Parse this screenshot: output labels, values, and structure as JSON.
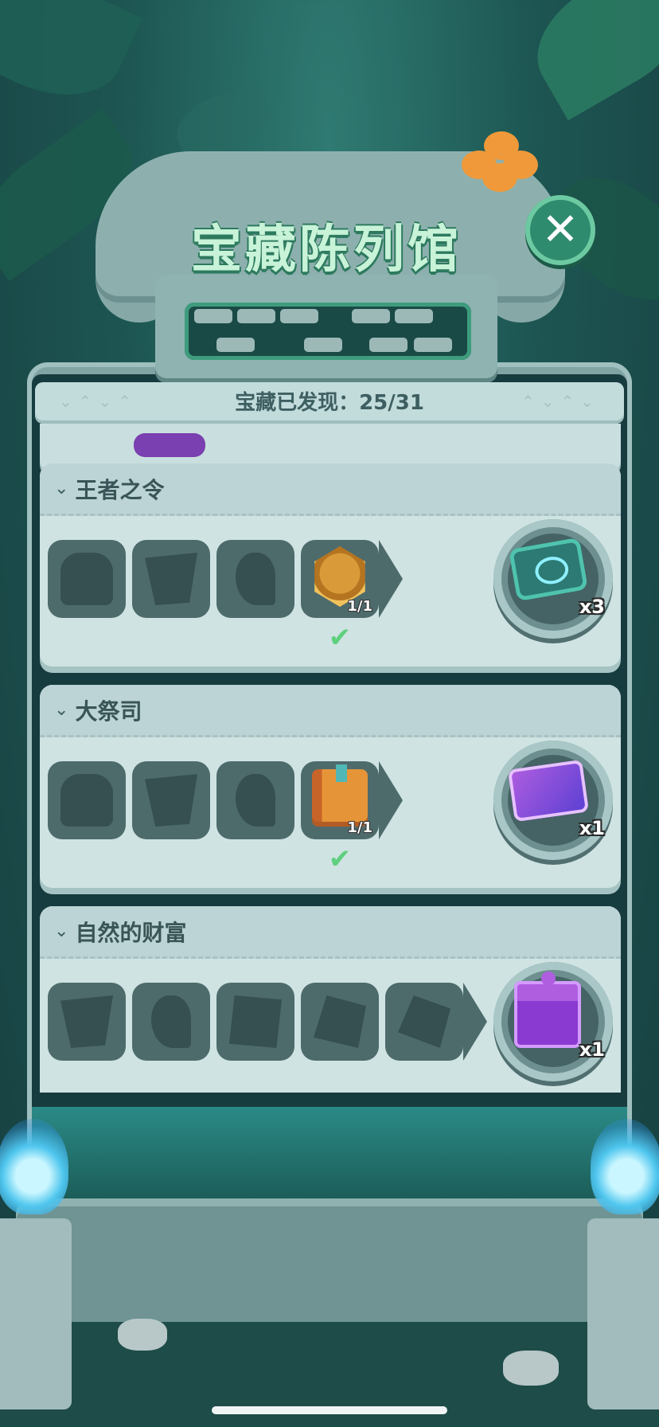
{
  "header": {
    "title": "宝藏陈列馆",
    "close_icon": "close-icon"
  },
  "counter": {
    "label": "宝藏已发现：25/31"
  },
  "collections": [
    {
      "title": "王者之令",
      "items": [
        {
          "icon": "glove-silhouette",
          "found": false
        },
        {
          "icon": "scroll-silhouette",
          "found": false
        },
        {
          "icon": "mickey-torch-silhouette",
          "found": false
        },
        {
          "icon": "mickey-medal",
          "found": true,
          "count": "1/1"
        }
      ],
      "reward": {
        "icon": "eye-ticket-icon",
        "qty": "x3"
      }
    },
    {
      "title": "大祭司",
      "items": [
        {
          "icon": "glove-silhouette",
          "found": false
        },
        {
          "icon": "scroll-silhouette",
          "found": false
        },
        {
          "icon": "mickey-torch-silhouette",
          "found": false
        },
        {
          "icon": "mickey-book",
          "found": true,
          "count": "1/1"
        }
      ],
      "reward": {
        "icon": "mickey-card-icon",
        "qty": "x1"
      }
    },
    {
      "title": "自然的财富",
      "items": [
        {
          "icon": "scroll-silhouette",
          "found": false
        },
        {
          "icon": "mickey-torch-silhouette",
          "found": false
        },
        {
          "icon": "tablet-silhouette",
          "found": false
        },
        {
          "icon": "rock-silhouette",
          "found": false
        },
        {
          "icon": "hexagon-silhouette",
          "found": false
        }
      ],
      "reward": {
        "icon": "gift-box-icon",
        "qty": "x1"
      }
    }
  ],
  "colors": {
    "accent_green": "#5fd07d",
    "panel": "#cfe3e3",
    "tile": "#4e6b6c"
  }
}
